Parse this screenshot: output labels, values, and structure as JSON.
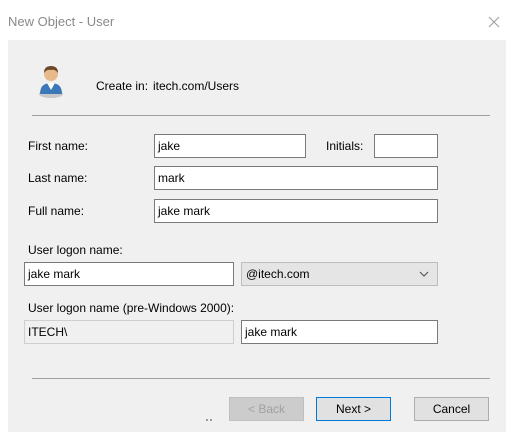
{
  "window": {
    "title": "New Object - User"
  },
  "header": {
    "create_in_label": "Create in:",
    "create_in_value": "itech.com/Users",
    "icon": "user-icon"
  },
  "form": {
    "first_name_label": "First name:",
    "first_name_value": "jake",
    "initials_label": "Initials:",
    "initials_value": "",
    "last_name_label": "Last name:",
    "last_name_value": "mark",
    "full_name_label": "Full name:",
    "full_name_value": "jake mark",
    "logon_label": "User logon name:",
    "logon_value": "jake mark",
    "domain_selected": "@itech.com",
    "pre2000_label": "User logon name (pre-Windows 2000):",
    "pre2000_domain": "ITECH\\",
    "pre2000_value": "jake mark"
  },
  "buttons": {
    "back_label": "< Back",
    "next_label": "Next >",
    "cancel_label": "Cancel"
  },
  "colors": {
    "dialog_bg": "#f0f0f0",
    "accent": "#0078d7"
  }
}
